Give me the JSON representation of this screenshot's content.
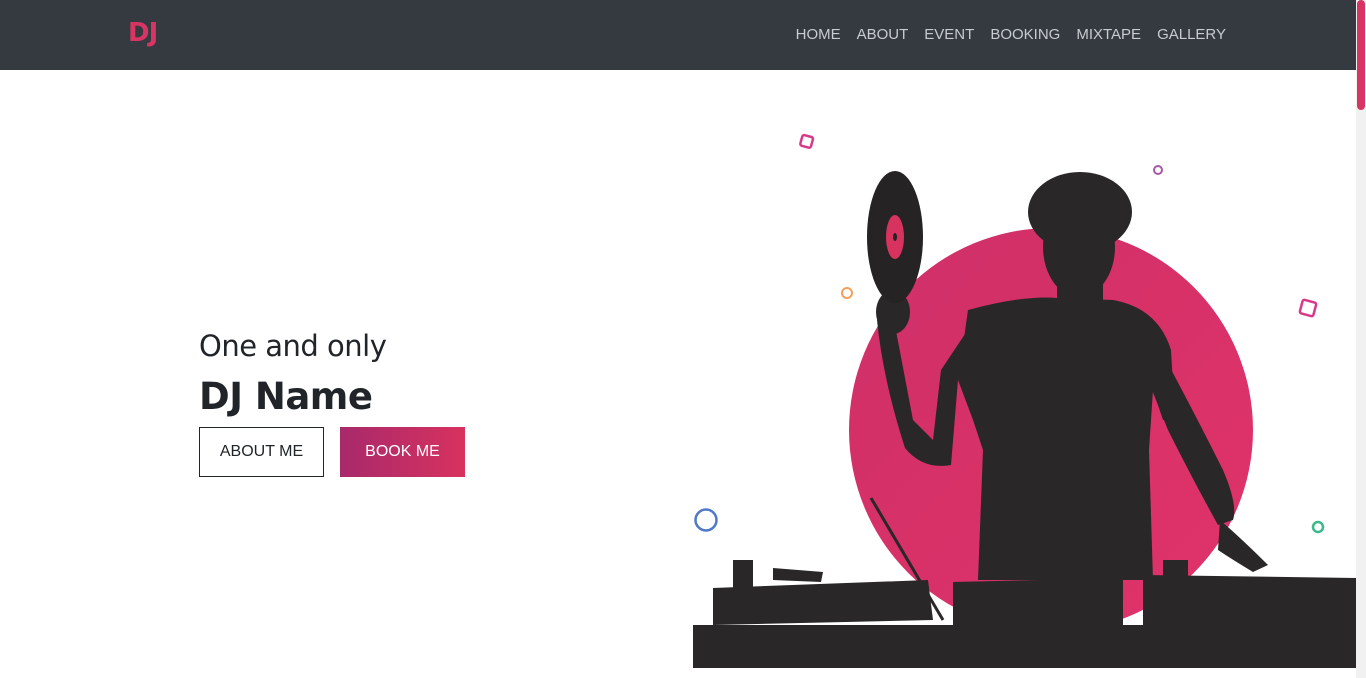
{
  "navbar": {
    "brand": "DJ",
    "links": [
      "HOME",
      "ABOUT",
      "EVENT",
      "BOOKING",
      "MIXTAPE",
      "GALLERY"
    ]
  },
  "hero": {
    "subtitle": "One and only",
    "title": "DJ Name",
    "about_button": "ABOUT ME",
    "book_button": "BOOK ME",
    "image_icon": "dj-silhouette-illustration"
  },
  "colors": {
    "navbar_bg": "#343a40",
    "accent": "#d83464",
    "accent_gradient_start": "#a8296b",
    "nav_text": "#c8cbcf",
    "text": "#212529"
  }
}
